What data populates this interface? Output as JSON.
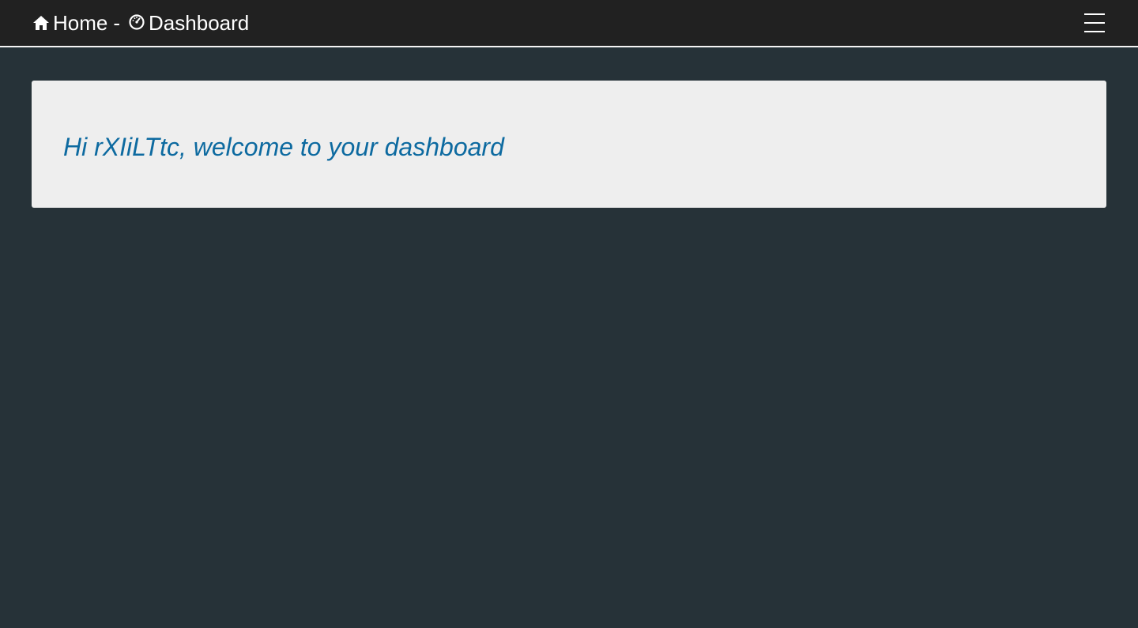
{
  "navbar": {
    "home_label": "Home",
    "separator": "-",
    "dashboard_label": "Dashboard",
    "home_icon": "home-icon",
    "dashboard_icon": "dashboard-gauge-icon",
    "menu_icon": "hamburger-menu-icon"
  },
  "main": {
    "welcome_text": "Hi rXIiLTtc, welcome to your dashboard"
  },
  "colors": {
    "page_background": "#263238",
    "navbar_background": "#212121",
    "panel_background": "#eeeeee",
    "welcome_text": "#0d6aa0"
  }
}
